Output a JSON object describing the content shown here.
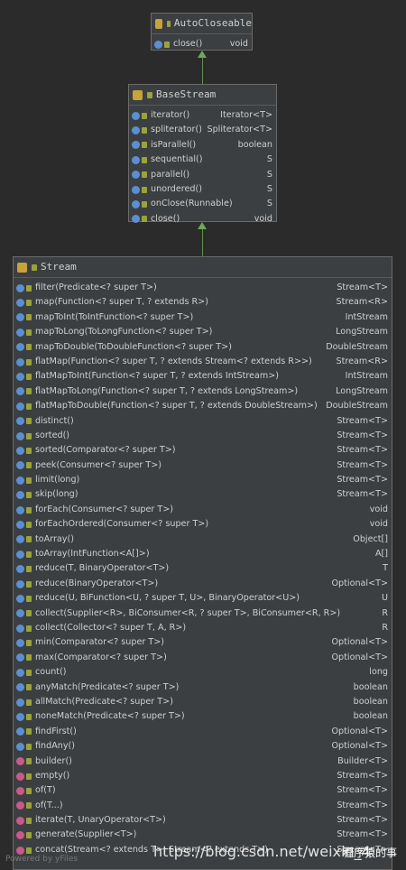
{
  "boxes": {
    "autocloseable": {
      "title": "AutoCloseable",
      "rows": [
        {
          "sig": "close()",
          "ret": "void"
        }
      ]
    },
    "basestream": {
      "title": "BaseStream",
      "rows": [
        {
          "sig": "iterator()",
          "ret": "Iterator<T>"
        },
        {
          "sig": "spliterator()",
          "ret": "Spliterator<T>"
        },
        {
          "sig": "isParallel()",
          "ret": "boolean"
        },
        {
          "sig": "sequential()",
          "ret": "S"
        },
        {
          "sig": "parallel()",
          "ret": "S"
        },
        {
          "sig": "unordered()",
          "ret": "S"
        },
        {
          "sig": "onClose(Runnable)",
          "ret": "S"
        },
        {
          "sig": "close()",
          "ret": "void"
        }
      ]
    },
    "stream": {
      "title": "Stream",
      "rows": [
        {
          "sig": "filter(Predicate<? super T>)",
          "ret": "Stream<T>"
        },
        {
          "sig": "map(Function<? super T, ? extends R>)",
          "ret": "Stream<R>"
        },
        {
          "sig": "mapToInt(ToIntFunction<? super T>)",
          "ret": "IntStream"
        },
        {
          "sig": "mapToLong(ToLongFunction<? super T>)",
          "ret": "LongStream"
        },
        {
          "sig": "mapToDouble(ToDoubleFunction<? super T>)",
          "ret": "DoubleStream"
        },
        {
          "sig": "flatMap(Function<? super T, ? extends Stream<? extends R>>)",
          "ret": "Stream<R>"
        },
        {
          "sig": "flatMapToInt(Function<? super T, ? extends IntStream>)",
          "ret": "IntStream"
        },
        {
          "sig": "flatMapToLong(Function<? super T, ? extends LongStream>)",
          "ret": "LongStream"
        },
        {
          "sig": "flatMapToDouble(Function<? super T, ? extends DoubleStream>)",
          "ret": "DoubleStream"
        },
        {
          "sig": "distinct()",
          "ret": "Stream<T>"
        },
        {
          "sig": "sorted()",
          "ret": "Stream<T>"
        },
        {
          "sig": "sorted(Comparator<? super T>)",
          "ret": "Stream<T>"
        },
        {
          "sig": "peek(Consumer<? super T>)",
          "ret": "Stream<T>"
        },
        {
          "sig": "limit(long)",
          "ret": "Stream<T>"
        },
        {
          "sig": "skip(long)",
          "ret": "Stream<T>"
        },
        {
          "sig": "forEach(Consumer<? super T>)",
          "ret": "void"
        },
        {
          "sig": "forEachOrdered(Consumer<? super T>)",
          "ret": "void"
        },
        {
          "sig": "toArray()",
          "ret": "Object[]"
        },
        {
          "sig": "toArray(IntFunction<A[]>)",
          "ret": "A[]"
        },
        {
          "sig": "reduce(T, BinaryOperator<T>)",
          "ret": "T"
        },
        {
          "sig": "reduce(BinaryOperator<T>)",
          "ret": "Optional<T>"
        },
        {
          "sig": "reduce(U, BiFunction<U, ? super T, U>, BinaryOperator<U>)",
          "ret": "U"
        },
        {
          "sig": "collect(Supplier<R>, BiConsumer<R, ? super T>, BiConsumer<R, R>)",
          "ret": "R"
        },
        {
          "sig": "collect(Collector<? super T, A, R>)",
          "ret": "R"
        },
        {
          "sig": "min(Comparator<? super T>)",
          "ret": "Optional<T>"
        },
        {
          "sig": "max(Comparator<? super T>)",
          "ret": "Optional<T>"
        },
        {
          "sig": "count()",
          "ret": "long"
        },
        {
          "sig": "anyMatch(Predicate<? super T>)",
          "ret": "boolean"
        },
        {
          "sig": "allMatch(Predicate<? super T>)",
          "ret": "boolean"
        },
        {
          "sig": "noneMatch(Predicate<? super T>)",
          "ret": "boolean"
        },
        {
          "sig": "findFirst()",
          "ret": "Optional<T>"
        },
        {
          "sig": "findAny()",
          "ret": "Optional<T>"
        },
        {
          "sig": "builder()",
          "ret": "Builder<T>",
          "static": true
        },
        {
          "sig": "empty()",
          "ret": "Stream<T>",
          "static": true
        },
        {
          "sig": "of(T)",
          "ret": "Stream<T>",
          "static": true
        },
        {
          "sig": "of(T...)",
          "ret": "Stream<T>",
          "static": true
        },
        {
          "sig": "iterate(T, UnaryOperator<T>)",
          "ret": "Stream<T>",
          "static": true
        },
        {
          "sig": "generate(Supplier<T>)",
          "ret": "Stream<T>",
          "static": true
        },
        {
          "sig": "concat(Stream<? extends T>, Stream<? extends T>)",
          "ret": "Stream<T>",
          "static": true
        }
      ]
    }
  },
  "watermark": {
    "url": "https://blog.csdn.net/weixin_4",
    "brand": "程序猿的事"
  },
  "footer": "Powered by yFiles",
  "colors": {
    "background": "#2b2b2b",
    "box": "#3c3f41",
    "arrow": "#6ea85a"
  }
}
